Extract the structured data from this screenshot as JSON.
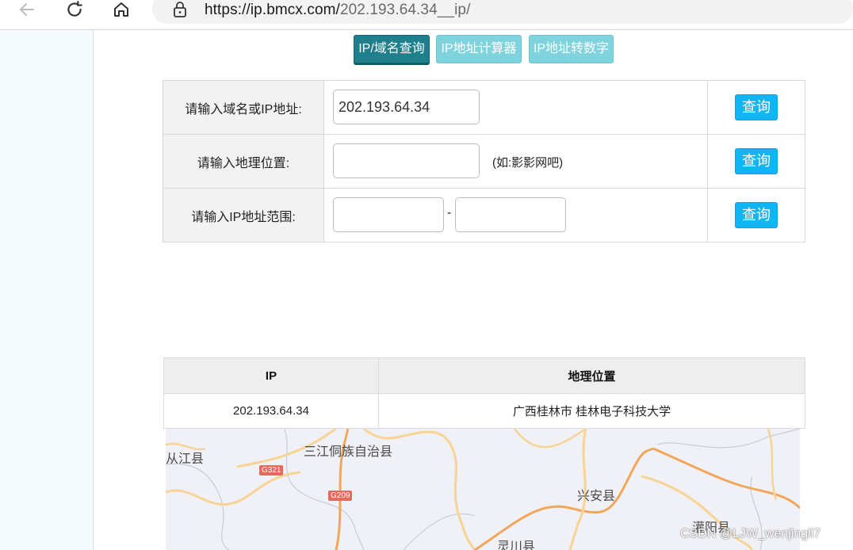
{
  "browser": {
    "url_host": "https://ip.bmcx.com/",
    "url_path": "202.193.64.34__ip/"
  },
  "tabs": [
    {
      "label": "IP/域名查询"
    },
    {
      "label": "IP地址计算器"
    },
    {
      "label": "IP地址转数字"
    }
  ],
  "query": {
    "row1_label": "请输入域名或IP地址:",
    "row1_value": "202.193.64.34",
    "row2_label": "请输入地理位置:",
    "row2_value": "",
    "row2_hint": "(如:影影网吧)",
    "row3_label": "请输入IP地址范围:",
    "row3_from": "",
    "row3_separator": "-",
    "row3_to": "",
    "button_label": "查询"
  },
  "result": {
    "headers": [
      "IP",
      "地理位置"
    ],
    "rows": [
      {
        "ip": "202.193.64.34",
        "location": "广西桂林市 桂林电子科技大学"
      }
    ]
  },
  "map": {
    "places": [
      "从江县",
      "三江侗族自治县",
      "兴安县",
      "灌阳县",
      "灵川县"
    ],
    "shields": [
      "G321",
      "G209"
    ]
  },
  "watermark": "CSDN @LJW_wenjingli7"
}
